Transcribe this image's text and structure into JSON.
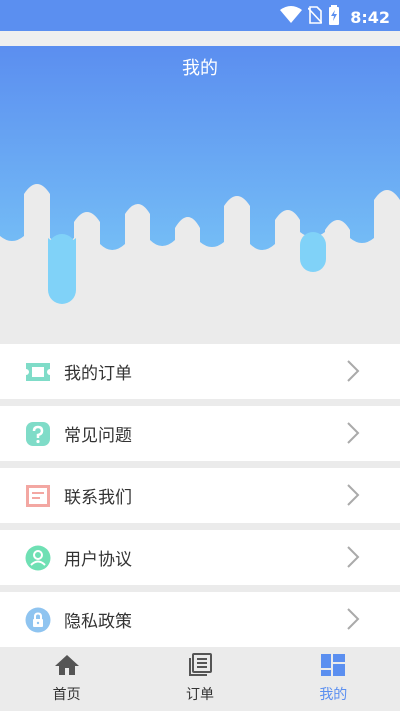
{
  "status_bar": {
    "time": "8:42"
  },
  "header": {
    "title": "我的"
  },
  "menu": {
    "items": [
      {
        "label": "我的订单",
        "icon": "ticket-icon"
      },
      {
        "label": "常见问题",
        "icon": "question-icon"
      },
      {
        "label": "联系我们",
        "icon": "message-icon"
      },
      {
        "label": "用户协议",
        "icon": "user-icon"
      },
      {
        "label": "隐私政策",
        "icon": "lock-icon"
      }
    ]
  },
  "tabbar": {
    "tabs": [
      {
        "label": "首页",
        "icon": "home-icon"
      },
      {
        "label": "订单",
        "icon": "list-icon"
      },
      {
        "label": "我的",
        "icon": "grid-icon",
        "active": true
      }
    ]
  },
  "colors": {
    "accent": "#5b8ff0",
    "hero_top": "#5b8ef0",
    "hero_bottom": "#7fd1f8",
    "background": "#ebebeb"
  }
}
